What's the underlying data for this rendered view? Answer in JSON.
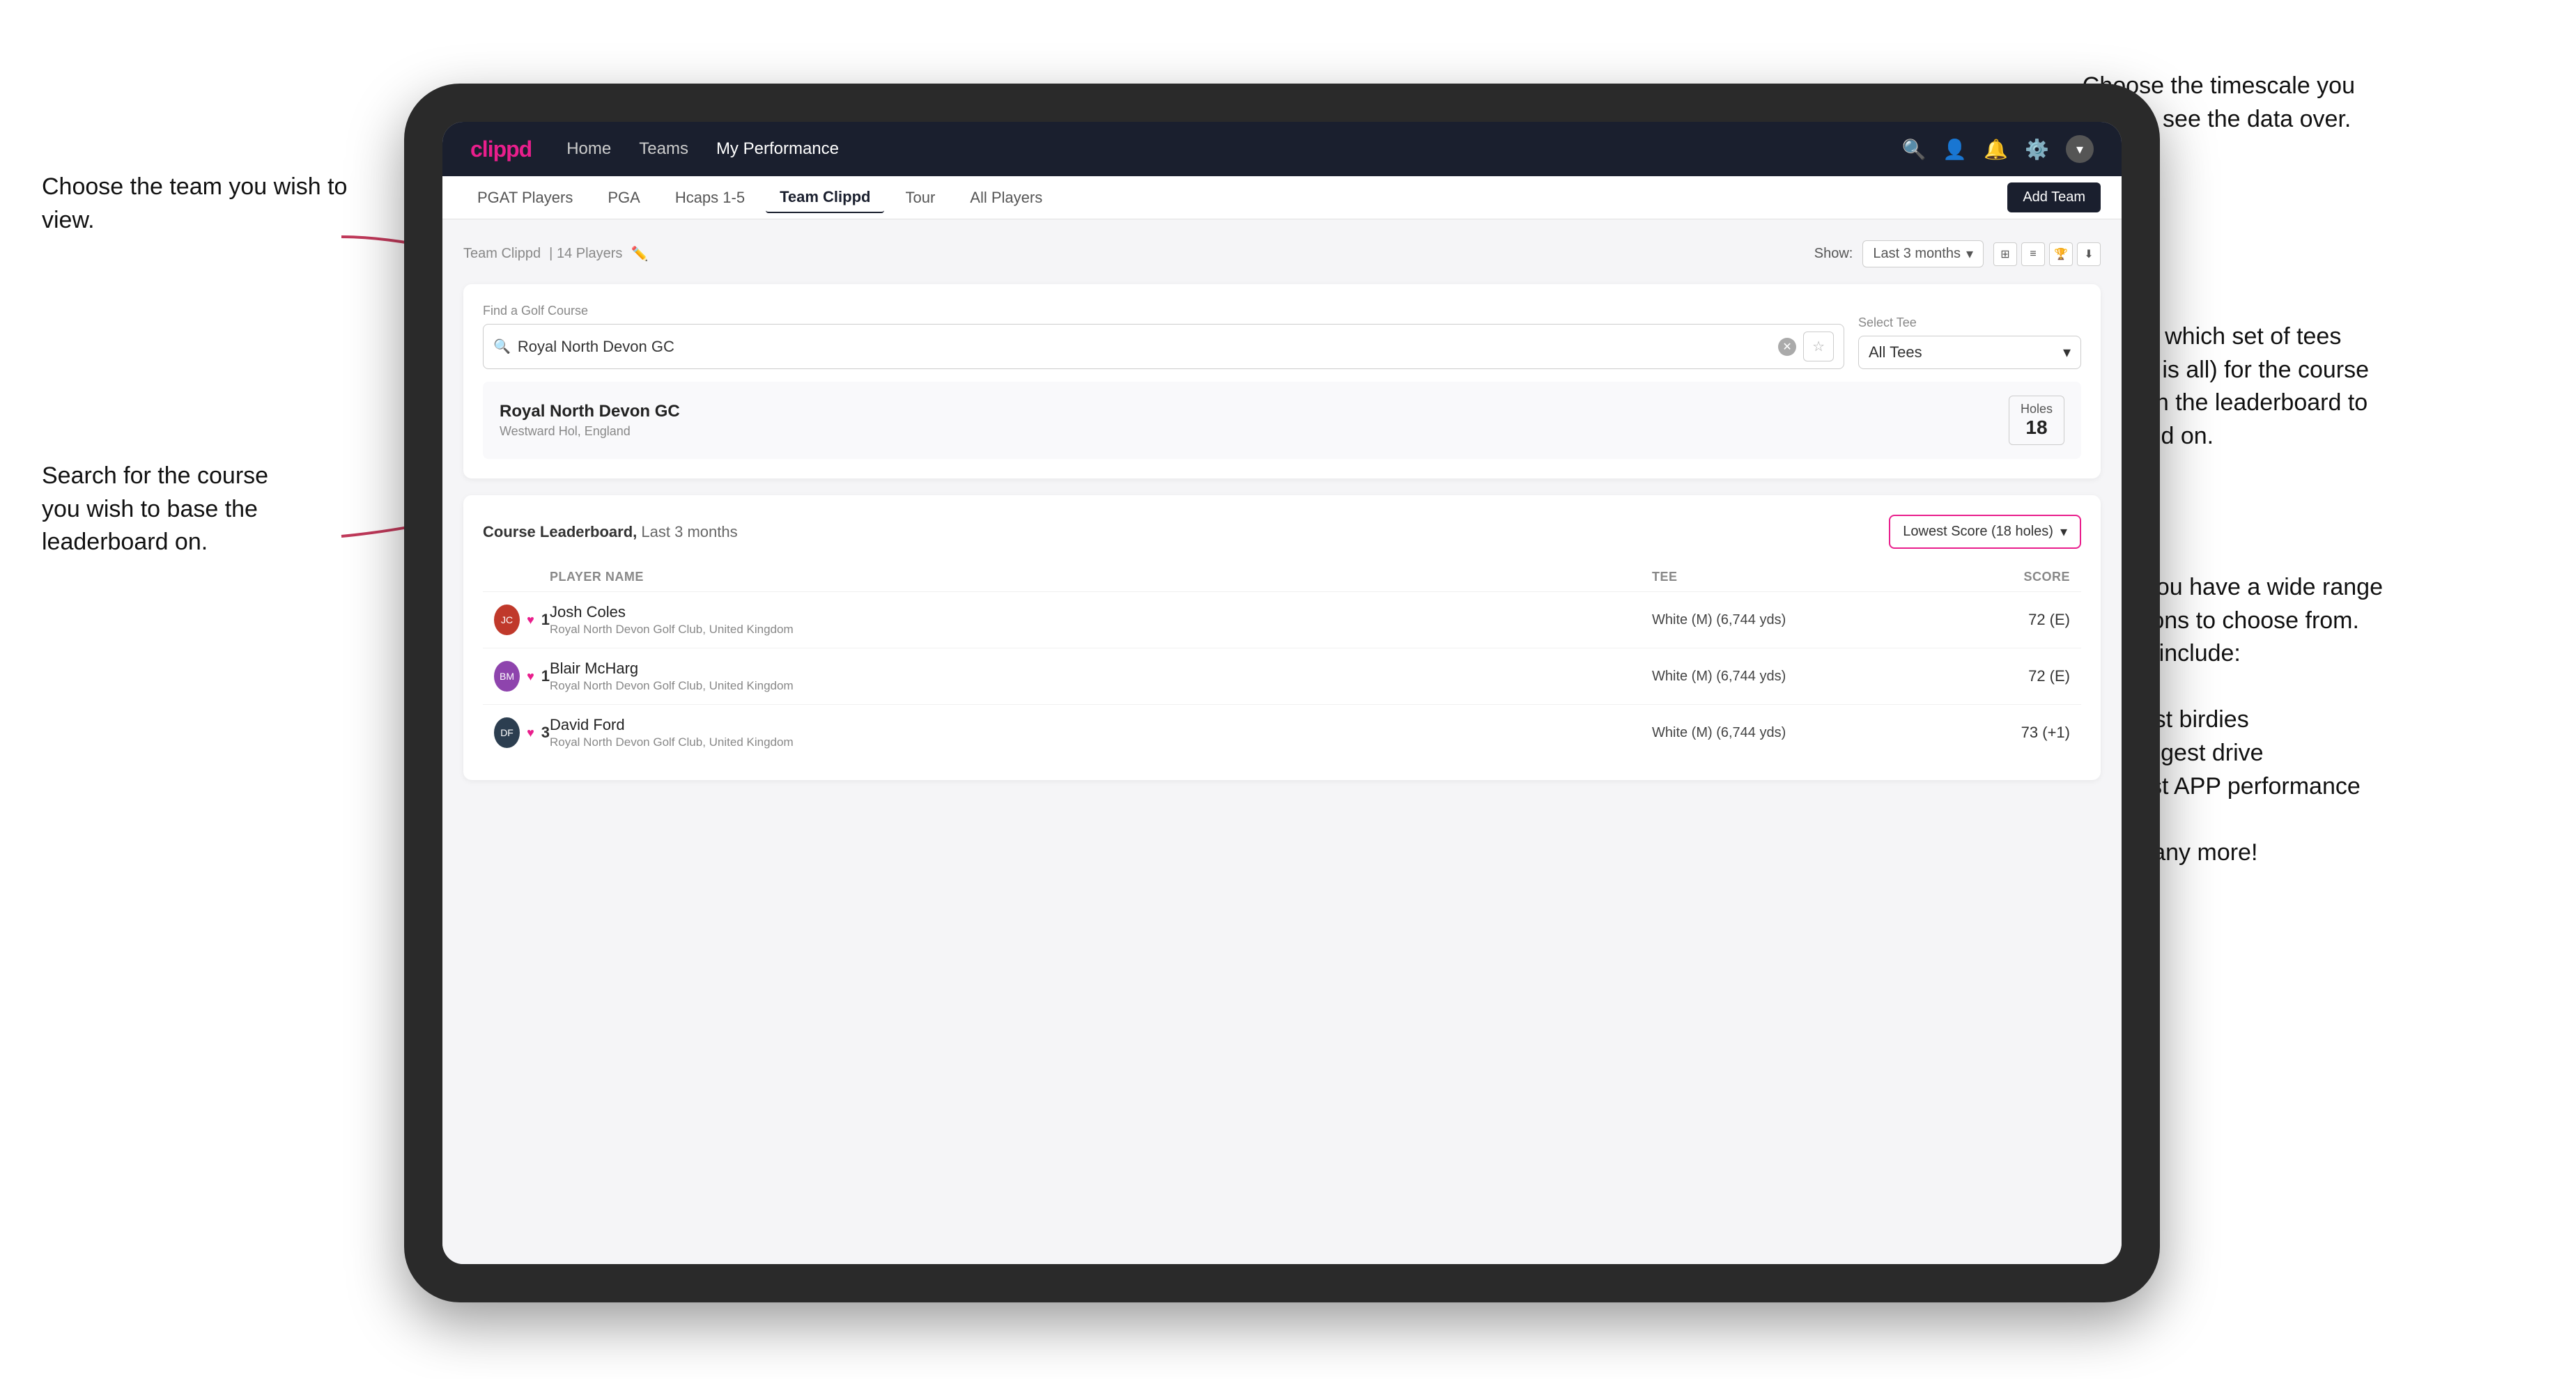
{
  "annotations": {
    "team_annotation": "Choose the team you\nwish to view.",
    "timescale_annotation": "Choose the timescale you\nwish to see the data over.",
    "tee_annotation": "Choose which set of tees\n(default is all) for the course\nyou wish the leaderboard to\nbe based on.",
    "course_annotation": "Search for the course\nyou wish to base the\nleaderboard on.",
    "options_annotation_title": "Here you have a wide range\nof options to choose from.\nThese include:",
    "options_list": [
      "Most birdies",
      "Longest drive",
      "Best APP performance"
    ],
    "options_more": "and many more!"
  },
  "navbar": {
    "logo": "clippd",
    "nav_items": [
      "Home",
      "Teams",
      "My Performance"
    ],
    "active_nav": "My Performance"
  },
  "sub_tabs": {
    "items": [
      "PGAT Players",
      "PGA",
      "Hcaps 1-5",
      "Team Clippd",
      "Tour",
      "All Players"
    ],
    "active": "Team Clippd",
    "add_team_label": "Add Team"
  },
  "team_header": {
    "title": "Team Clippd",
    "player_count": "14 Players",
    "show_label": "Show:",
    "period": "Last 3 months"
  },
  "course_search": {
    "label": "Find a Golf Course",
    "value": "Royal North Devon GC",
    "tee_label": "Select Tee",
    "tee_value": "All Tees"
  },
  "course_result": {
    "name": "Royal North Devon GC",
    "location": "Westward Hol, England",
    "holes_label": "Holes",
    "holes_value": "18"
  },
  "leaderboard": {
    "title": "Course Leaderboard,",
    "period": "Last 3 months",
    "score_type": "Lowest Score (18 holes)",
    "col_headers": [
      "",
      "PLAYER NAME",
      "TEE",
      "SCORE"
    ],
    "players": [
      {
        "rank": "1",
        "name": "Josh Coles",
        "club": "Royal North Devon Golf Club, United Kingdom",
        "tee": "White (M) (6,744 yds)",
        "score": "72 (E)",
        "avatar_color": "#c0392b"
      },
      {
        "rank": "1",
        "name": "Blair McHarg",
        "club": "Royal North Devon Golf Club, United Kingdom",
        "tee": "White (M) (6,744 yds)",
        "score": "72 (E)",
        "avatar_color": "#8e44ad"
      },
      {
        "rank": "3",
        "name": "David Ford",
        "club": "Royal North Devon Golf Club, United Kingdom",
        "tee": "White (M) (6,744 yds)",
        "score": "73 (+1)",
        "avatar_color": "#2c3e50"
      }
    ]
  }
}
